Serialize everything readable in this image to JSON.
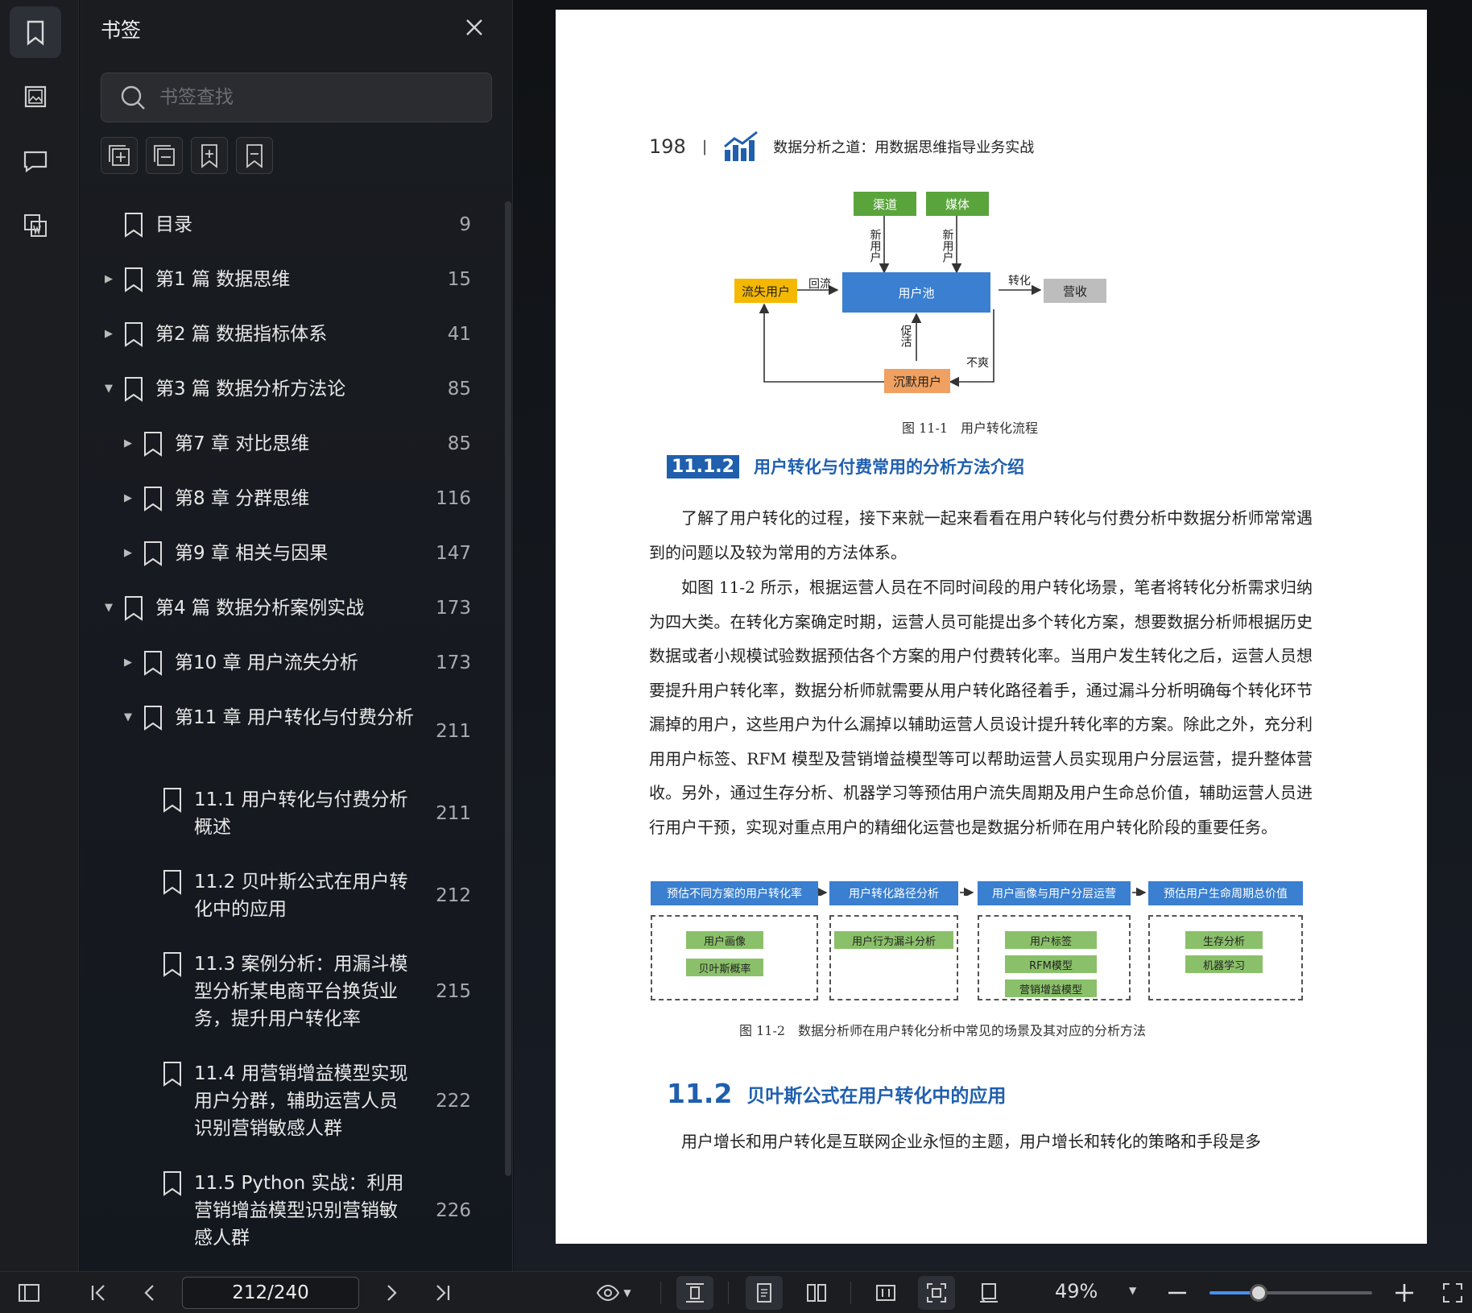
{
  "sidebar_panel": {
    "title": "书签",
    "search_placeholder": "书签查找",
    "items": [
      {
        "label": "目录",
        "page": "9",
        "arrow": "",
        "indent": 0
      },
      {
        "label": "第1 篇 数据思维",
        "page": "15",
        "arrow": "▶",
        "indent": 0
      },
      {
        "label": "第2 篇 数据指标体系",
        "page": "41",
        "arrow": "▶",
        "indent": 0
      },
      {
        "label": "第3 篇 数据分析方法论",
        "page": "85",
        "arrow": "▼",
        "indent": 0
      },
      {
        "label": "第7 章 对比思维",
        "page": "85",
        "arrow": "▶",
        "indent": 1
      },
      {
        "label": "第8 章 分群思维",
        "page": "116",
        "arrow": "▶",
        "indent": 1
      },
      {
        "label": "第9 章 相关与因果",
        "page": "147",
        "arrow": "▶",
        "indent": 1
      },
      {
        "label": "第4 篇 数据分析案例实战",
        "page": "173",
        "arrow": "▼",
        "indent": 0
      },
      {
        "label": "第10 章 用户流失分析",
        "page": "173",
        "arrow": "▶",
        "indent": 1
      },
      {
        "label": "第11 章 用户转化与付费分析",
        "page": "211",
        "arrow": "▼",
        "indent": 1
      },
      {
        "label": "11.1 用户转化与付费分析概述",
        "page": "211",
        "arrow": "",
        "indent": 2
      },
      {
        "label": "11.2 贝叶斯公式在用户转化中的应用",
        "page": "212",
        "arrow": "",
        "indent": 2,
        "selected": true
      },
      {
        "label": "11.3 案例分析：用漏斗模型分析某电商平台换货业务，提升用户转化率",
        "page": "215",
        "arrow": "",
        "indent": 2
      },
      {
        "label": "11.4 用营销增益模型实现用户分群，辅助运营人员识别营销敏感人群",
        "page": "222",
        "arrow": "",
        "indent": 2
      },
      {
        "label": "11.5 Python 实战：利用营销增益模型识别营销敏感人群",
        "page": "226",
        "arrow": "",
        "indent": 2
      }
    ]
  },
  "document": {
    "page_number": "198",
    "book_title": "数据分析之道：用数据思维指导业务实战",
    "figure1": {
      "channel": "渠道",
      "media": "媒体",
      "new_user_1": "新用户",
      "new_user_2": "新用户",
      "churn": "流失用户",
      "reflow": "回流",
      "pool": "用户池",
      "convert": "转化",
      "revenue": "营收",
      "activate": "促活",
      "unhappy": "不爽",
      "silent": "沉默用户",
      "caption": "图 11-1　用户转化流程"
    },
    "section1_num": "11.1.2",
    "section1_title": "用户转化与付费常用的分析方法介绍",
    "para1": "了解了用户转化的过程，接下来就一起来看看在用户转化与付费分析中数据分析师常常遇到的问题以及较为常用的方法体系。",
    "para2": "如图 11-2 所示，根据运营人员在不同时间段的用户转化场景，笔者将转化分析需求归纳为四大类。在转化方案确定时期，运营人员可能提出多个转化方案，想要数据分析师根据历史数据或者小规模试验数据预估各个方案的用户付费转化率。当用户发生转化之后，运营人员想要提升用户转化率，数据分析师就需要从用户转化路径着手，通过漏斗分析明确每个转化环节漏掉的用户，这些用户为什么漏掉以辅助运营人员设计提升转化率的方案。除此之外，充分利用用户标签、RFM 模型及营销增益模型等可以帮助运营人员实现用户分层运营，提升整体营收。另外，通过生存分析、机器学习等预估用户流失周期及用户生命总价值，辅助运营人员进行用户干预，实现对重点用户的精细化运营也是数据分析师在用户转化阶段的重要任务。",
    "figure2": {
      "heads": [
        "预估不同方案的用户转化率",
        "用户转化路径分析",
        "用户画像与用户分层运营",
        "预估用户生命周期总价值"
      ],
      "col1": [
        "用户画像",
        "贝叶斯概率"
      ],
      "col2": [
        "用户行为漏斗分析"
      ],
      "col3": [
        "用户标签",
        "RFM模型",
        "营销增益模型"
      ],
      "col4": [
        "生存分析",
        "机器学习"
      ],
      "caption": "图 11-2　数据分析师在用户转化分析中常见的场景及其对应的分析方法"
    },
    "section2_num": "11.2",
    "section2_title": "贝叶斯公式在用户转化中的应用",
    "para3": "用户增长和用户转化是互联网企业永恒的主题，用户增长和转化的策略和手段是多"
  },
  "toolbar": {
    "page_indicator": "212/240",
    "zoom": "49%",
    "zoom_level": 0.3
  },
  "colors": {
    "accent": "#1f5fae",
    "slider": "#4a8ff0",
    "fig_green": "#5aa43c",
    "fig_blue": "#3a7fd0",
    "fig_yellow": "#f5b800",
    "fig_orange": "#f0a060",
    "fig_gray": "#bdbdbd"
  }
}
